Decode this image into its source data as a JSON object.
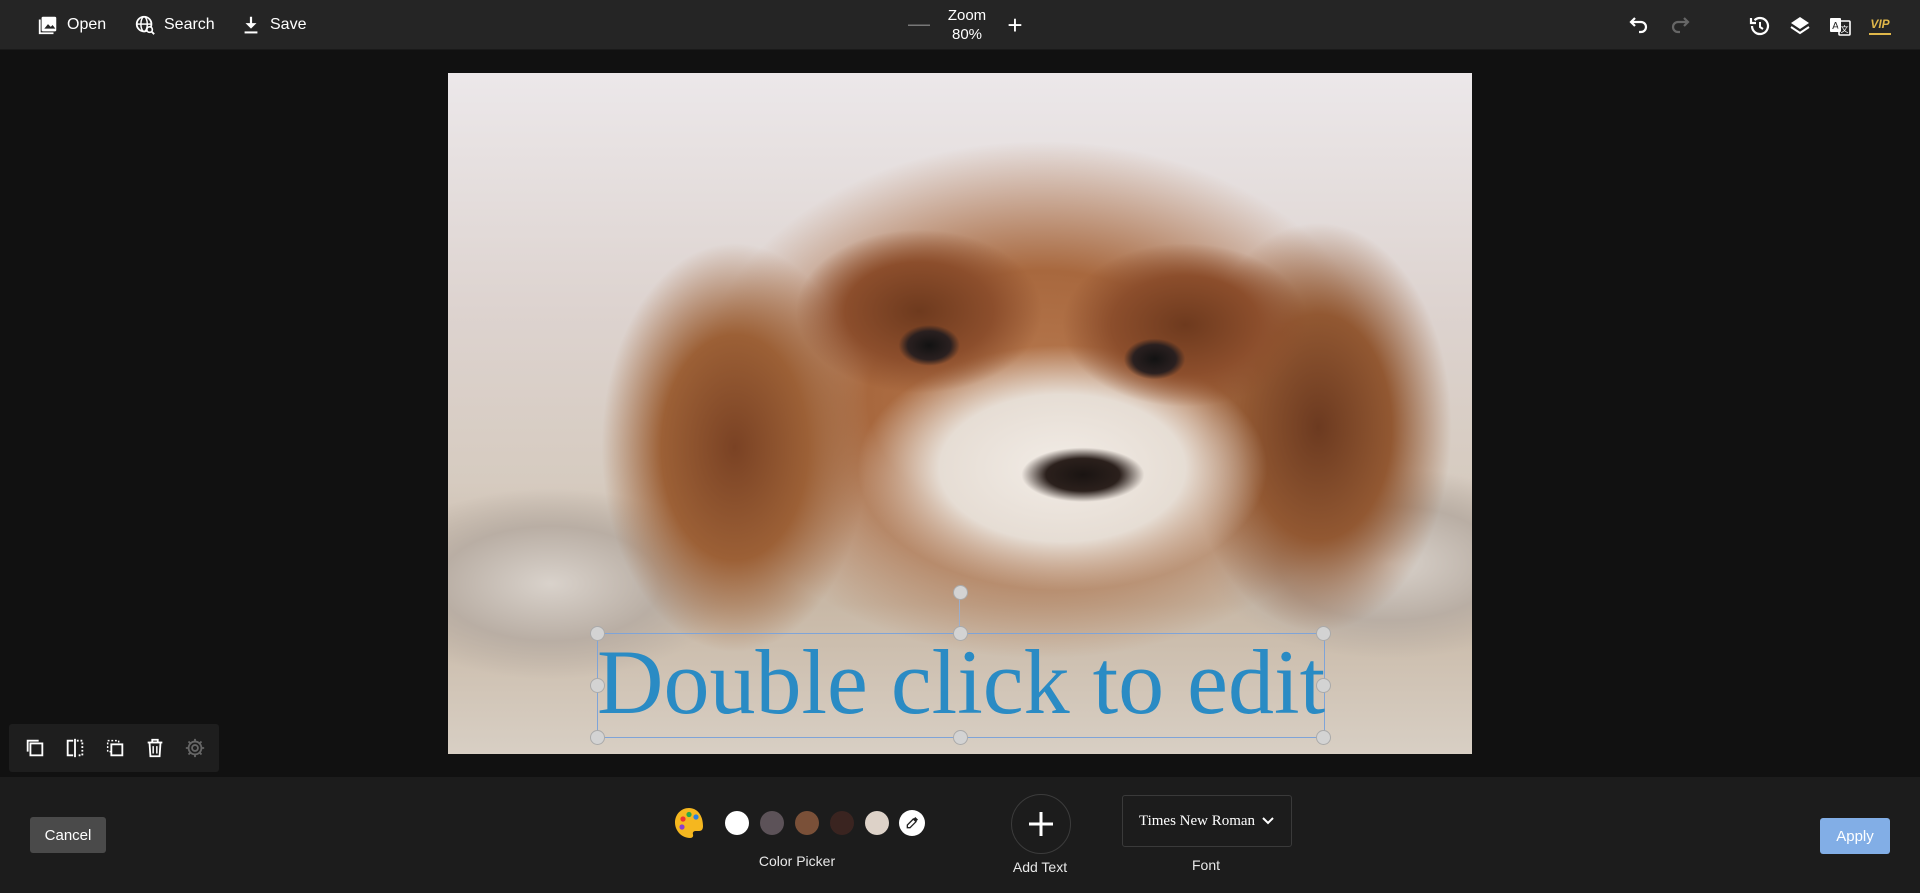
{
  "toolbar": {
    "open_label": "Open",
    "search_label": "Search",
    "save_label": "Save",
    "zoom_label": "Zoom",
    "zoom_value": "80%",
    "vip_label": "VIP"
  },
  "canvas": {
    "text_content": "Double click to edit",
    "text_color": "#2a8bc4"
  },
  "bottom_panel": {
    "cancel_label": "Cancel",
    "apply_label": "Apply",
    "color_picker_label": "Color Picker",
    "swatches": [
      "#ffffff",
      "#5c5258",
      "#7a5038",
      "#3a2420",
      "#ddd2c8"
    ],
    "add_text_label": "Add Text",
    "font_label": "Font",
    "font_value": "Times New Roman"
  },
  "colors": {
    "topbar_bg": "#252525",
    "workspace_bg": "#111111",
    "apply_accent": "#82aee6",
    "vip_gold": "#e0b74a",
    "selection_border": "#7fa4d8"
  }
}
